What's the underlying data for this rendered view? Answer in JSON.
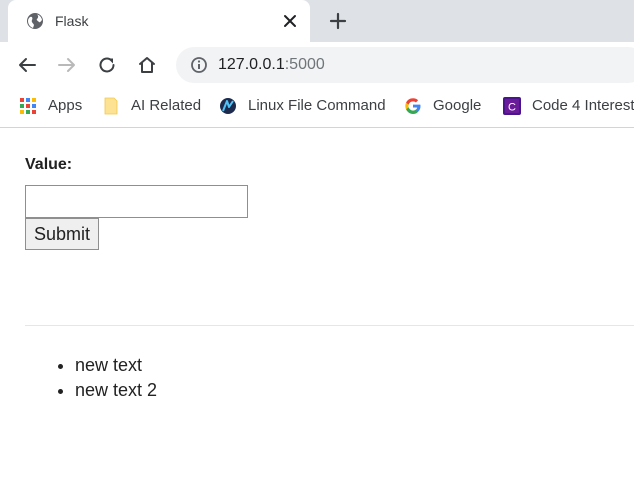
{
  "tab": {
    "title": "Flask"
  },
  "toolbar": {
    "url_host": "127.0.0.1",
    "url_port": ":5000"
  },
  "bookmarks": [
    {
      "label": "Apps",
      "icon": "apps-grid-icon"
    },
    {
      "label": "AI Related",
      "icon": "folder-icon"
    },
    {
      "label": "Linux File Command",
      "icon": "linux-site-icon"
    },
    {
      "label": "Google",
      "icon": "google-icon"
    },
    {
      "label": "Code 4 Interest",
      "icon": "code4interest-icon"
    }
  ],
  "form": {
    "label": "Value:",
    "input_value": "",
    "submit_label": "Submit"
  },
  "items": [
    "new text",
    "new text 2"
  ],
  "colors": {
    "tabstrip": "#dee1e6",
    "omnibox": "#f1f3f4",
    "google_blue": "#4285f4",
    "google_red": "#ea4335",
    "google_yellow": "#fbbc05",
    "google_green": "#34a853",
    "code_purple": "#6a1b9a"
  }
}
